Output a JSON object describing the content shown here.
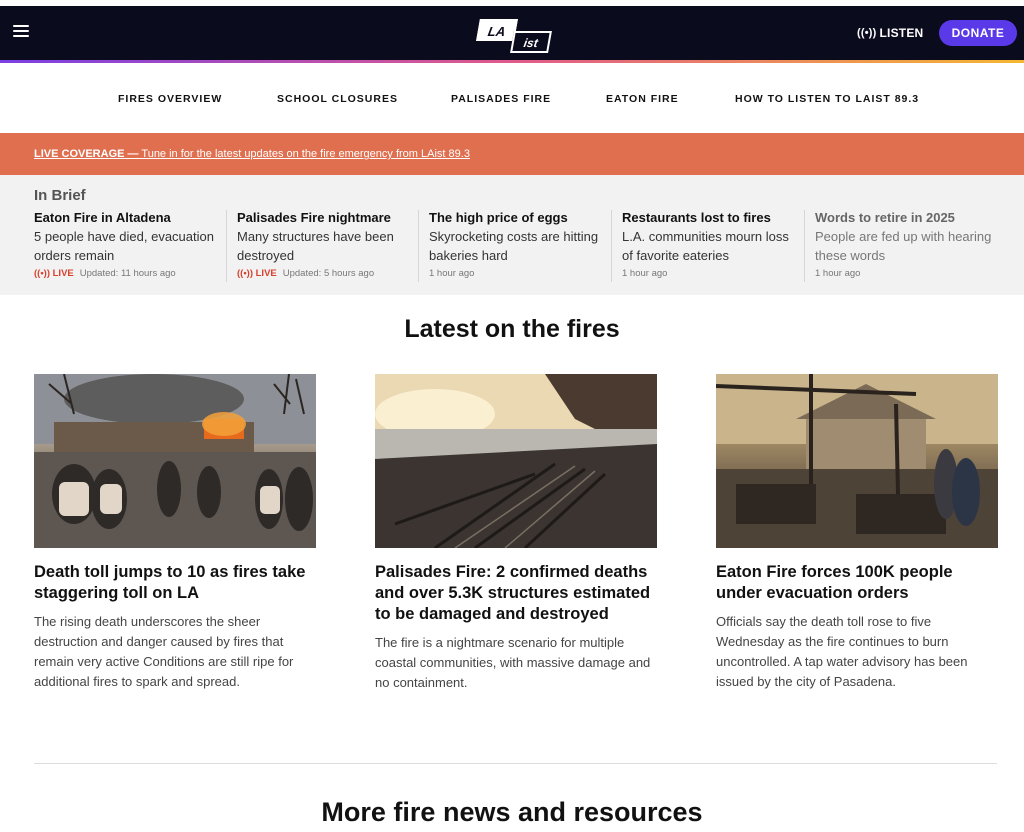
{
  "header": {
    "logo_top": "LA",
    "logo_bottom": "ist",
    "listen_label": "LISTEN",
    "donate_label": "DONATE",
    "bg_color": "#0b0b1e",
    "donate_color": "#5a3ae8"
  },
  "nav": [
    "FIRES OVERVIEW",
    "SCHOOL CLOSURES",
    "PALISADES FIRE",
    "EATON FIRE",
    "HOW TO LISTEN TO LAIST 89.3"
  ],
  "live_bar": {
    "prefix": "LIVE COVERAGE —",
    "text": " Tune in for the latest updates on the fire emergency from LAist 89.3",
    "color": "#e06f50"
  },
  "in_brief": {
    "label": "In Brief",
    "items": [
      {
        "title": "Eaton Fire in Altadena",
        "body": "5 people have died, evacuation orders remain",
        "live": "LIVE",
        "meta": "Updated: 11 hours ago"
      },
      {
        "title": "Palisades Fire nightmare",
        "body": "Many structures have been destroyed",
        "live": "LIVE",
        "meta": "Updated: 5 hours ago"
      },
      {
        "title": "The high price of eggs",
        "body": "Skyrocketing costs are hitting bakeries hard",
        "meta": "1 hour ago"
      },
      {
        "title": "Restaurants lost to fires",
        "body": "L.A. communities mourn loss of favorite eateries",
        "meta": "1 hour ago"
      },
      {
        "title": "Words to retire in 2025",
        "body": "People are fed up with hearing these words",
        "meta": "1 hour ago"
      }
    ]
  },
  "latest": {
    "title": "Latest on the fires",
    "cards": [
      {
        "title": "Death toll jumps to 10 as fires take staggering toll on LA",
        "body": "The rising death underscores the sheer destruction and danger caused by fires that remain very active Conditions are still ripe for additional fires to spark and spread."
      },
      {
        "title": "Palisades Fire: 2 confirmed deaths and over 5.3K structures estimated to be damaged and destroyed",
        "body": "The fire is a nightmare scenario for multiple coastal communities, with massive damage and no containment."
      },
      {
        "title": "Eaton Fire forces 100K people under evacuation orders",
        "body": "Officials say the death toll rose to five Wednesday as the fire continues to burn uncontrolled. A tap water advisory has been issued by the city of Pasadena."
      }
    ]
  },
  "more": {
    "title": "More fire news and resources"
  }
}
